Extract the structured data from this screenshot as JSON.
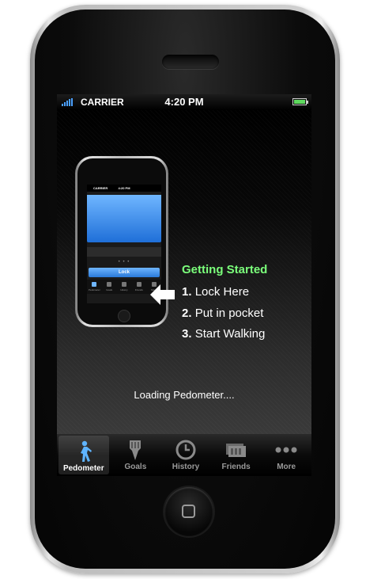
{
  "status_bar": {
    "carrier": "CARRIER",
    "time": "4:20 PM",
    "battery_level": 1.0
  },
  "mini_phone": {
    "carrier": "CARRIER",
    "time": "4:20 PM",
    "lock_label": "Lock",
    "dots": "• • •",
    "tabs": [
      "Pedometer",
      "Goals",
      "History",
      "Friends",
      "More"
    ]
  },
  "getting_started": {
    "title": "Getting Started",
    "steps": [
      {
        "num": "1.",
        "text": "Lock Here"
      },
      {
        "num": "2.",
        "text": "Put in pocket"
      },
      {
        "num": "3.",
        "text": "Start Walking"
      }
    ]
  },
  "loading_text": "Loading Pedometer....",
  "tabs": [
    {
      "label": "Pedometer",
      "icon": "walker-icon",
      "active": true
    },
    {
      "label": "Goals",
      "icon": "goals-icon",
      "active": false
    },
    {
      "label": "History",
      "icon": "clock-icon",
      "active": false
    },
    {
      "label": "Friends",
      "icon": "friends-icon",
      "active": false
    },
    {
      "label": "More",
      "icon": "more-icon",
      "active": false
    }
  ],
  "colors": {
    "accent_green": "#7bff7b",
    "accent_blue": "#4aa0ff"
  }
}
